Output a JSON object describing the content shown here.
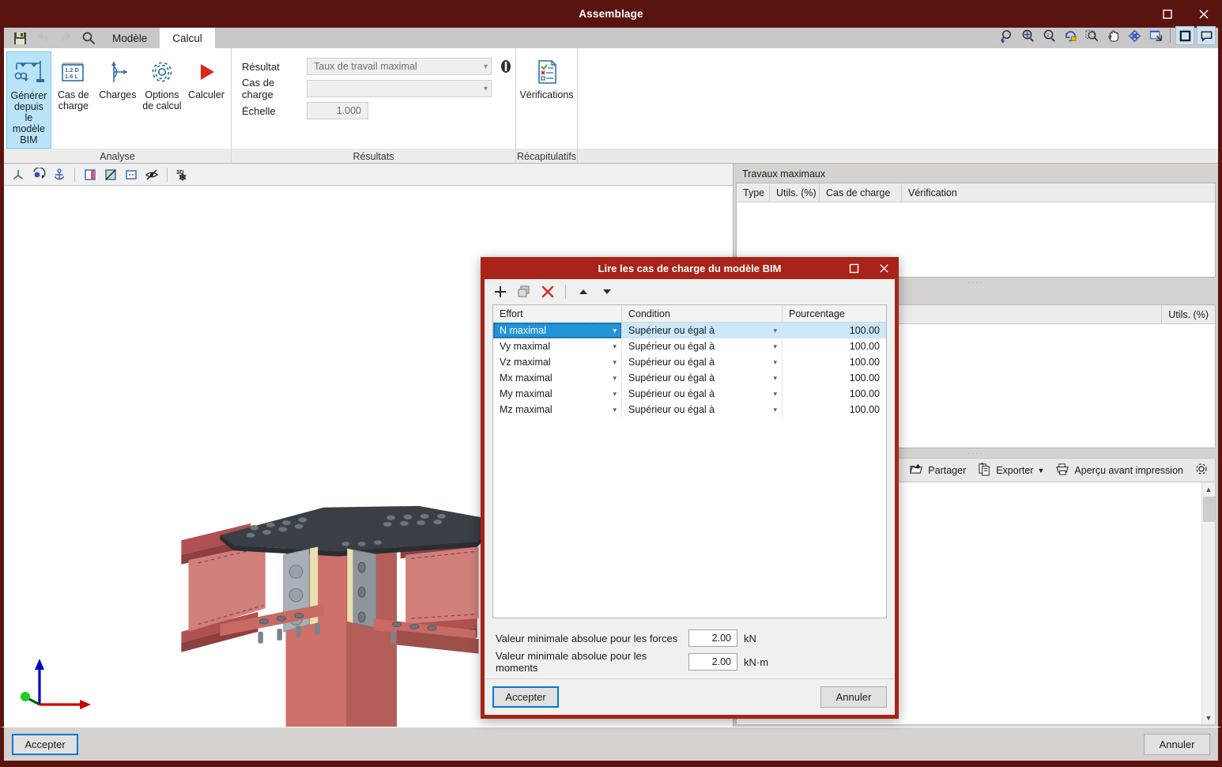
{
  "window": {
    "title": "Assemblage",
    "controls": [
      {
        "name": "maximize-button",
        "glyph": "□"
      },
      {
        "name": "close-button",
        "glyph": "✕"
      }
    ]
  },
  "quick_access": [
    {
      "name": "save-icon",
      "label": "save"
    },
    {
      "name": "undo-icon",
      "label": "undo"
    },
    {
      "name": "redo-icon",
      "label": "redo"
    },
    {
      "name": "search-icon",
      "label": "search"
    }
  ],
  "tabs": [
    {
      "label": "Modèle",
      "active": false
    },
    {
      "label": "Calcul",
      "active": true
    }
  ],
  "ribbon": {
    "groups": [
      {
        "label": "Analyse",
        "buttons": [
          {
            "label_line1": "Générer depuis",
            "label_line2": "le modèle BIM",
            "icon": "bim-generate-icon",
            "selected": true
          },
          {
            "label_line1": "Cas de",
            "label_line2": "charge",
            "icon": "load-case-icon",
            "selected": false
          },
          {
            "label_line1": "Charges",
            "label_line2": "",
            "icon": "loads-icon",
            "selected": false
          },
          {
            "label_line1": "Options",
            "label_line2": "de calcul",
            "icon": "calc-options-icon",
            "selected": false
          },
          {
            "label_line1": "Calculer",
            "label_line2": "",
            "icon": "run-calc-icon",
            "selected": false
          }
        ]
      },
      {
        "label": "Résultats",
        "fields": [
          {
            "label": "Résultat",
            "type": "combo",
            "value": "Taux de travail maximal"
          },
          {
            "label": "Cas de charge",
            "type": "combo",
            "value": ""
          },
          {
            "label": "Échelle",
            "type": "number",
            "value": "1.000"
          }
        ],
        "lock_icon": "lock-icon"
      },
      {
        "label": "Récapitulatifs",
        "buttons": [
          {
            "label_line1": "Vérifications",
            "label_line2": "",
            "icon": "verifications-icon",
            "selected": false
          }
        ]
      }
    ]
  },
  "view_toolbar": [
    {
      "name": "axes-icon"
    },
    {
      "name": "rotate-view-icon"
    },
    {
      "name": "anchor-icon"
    },
    {
      "name": "section-view-icon"
    },
    {
      "name": "diagram-icon"
    },
    {
      "name": "flat-view-icon"
    },
    {
      "name": "hide-icon"
    },
    {
      "name": "3d-view-icon"
    }
  ],
  "top_right_toolbar": [
    {
      "name": "zoom-in-icon"
    },
    {
      "name": "zoom-all-icon"
    },
    {
      "name": "zoom-previous-icon"
    },
    {
      "name": "zoom-redraw-icon"
    },
    {
      "name": "zoom-window-icon"
    },
    {
      "name": "pan-icon"
    },
    {
      "name": "orbit-icon"
    },
    {
      "name": "restore-view-icon"
    },
    {
      "name": "toggle-panel-icon"
    },
    {
      "name": "comments-icon"
    }
  ],
  "right_panel": {
    "top_section_title": "Travaux maximaux",
    "top_grid_columns": [
      "Type",
      "Utils. (%)",
      "Cas de charge",
      "Vérification"
    ],
    "top_grid_rows": [],
    "bottom_grid_columns": [
      "Utils. (%)"
    ],
    "bottom_grid_rows": [],
    "report_toolbar": [
      {
        "label": "Partager",
        "icon": "share-icon",
        "has_caret": false
      },
      {
        "label": "Exporter",
        "icon": "export-icon",
        "has_caret": true
      },
      {
        "label": "Aperçu avant impression",
        "icon": "print-preview-icon",
        "has_caret": false
      },
      {
        "label": "",
        "icon": "gear-icon",
        "has_caret": false
      }
    ]
  },
  "bottom_bar": {
    "accept_label": "Accepter",
    "cancel_label": "Annuler"
  },
  "dialog": {
    "title": "Lire les cas de charge du modèle BIM",
    "controls": [
      {
        "name": "dialog-maximize-button",
        "glyph": "□"
      },
      {
        "name": "dialog-close-button",
        "glyph": "✕"
      }
    ],
    "toolbar": [
      {
        "name": "add-row-icon"
      },
      {
        "name": "duplicate-row-icon"
      },
      {
        "name": "delete-row-icon"
      },
      {
        "name": "move-up-icon"
      },
      {
        "name": "move-down-icon"
      }
    ],
    "columns": [
      "Effort",
      "Condition",
      "Pourcentage"
    ],
    "rows": [
      {
        "effort": "N maximal",
        "condition": "Supérieur ou égal à",
        "pourcentage": "100.00",
        "selected": true
      },
      {
        "effort": "Vy maximal",
        "condition": "Supérieur ou égal à",
        "pourcentage": "100.00",
        "selected": false
      },
      {
        "effort": "Vz maximal",
        "condition": "Supérieur ou égal à",
        "pourcentage": "100.00",
        "selected": false
      },
      {
        "effort": "Mx maximal",
        "condition": "Supérieur ou égal à",
        "pourcentage": "100.00",
        "selected": false
      },
      {
        "effort": "My maximal",
        "condition": "Supérieur ou égal à",
        "pourcentage": "100.00",
        "selected": false
      },
      {
        "effort": "Mz maximal",
        "condition": "Supérieur ou égal à",
        "pourcentage": "100.00",
        "selected": false
      }
    ],
    "fields": [
      {
        "label": "Valeur minimale absolue pour les forces",
        "value": "2.00",
        "unit": "kN"
      },
      {
        "label": "Valeur minimale absolue pour les moments",
        "value": "2.00",
        "unit": "kN·m"
      }
    ],
    "accept_label": "Accepter",
    "cancel_label": "Annuler"
  },
  "colors": {
    "window_chrome": "#5a1410",
    "dialog_chrome": "#a82318",
    "selection_blue": "#2494d8",
    "selection_row": "#cbe8fb",
    "accent_focus": "#0078d7",
    "steel_red": "#cf6f6a",
    "plate_dark": "#3a3f45"
  }
}
